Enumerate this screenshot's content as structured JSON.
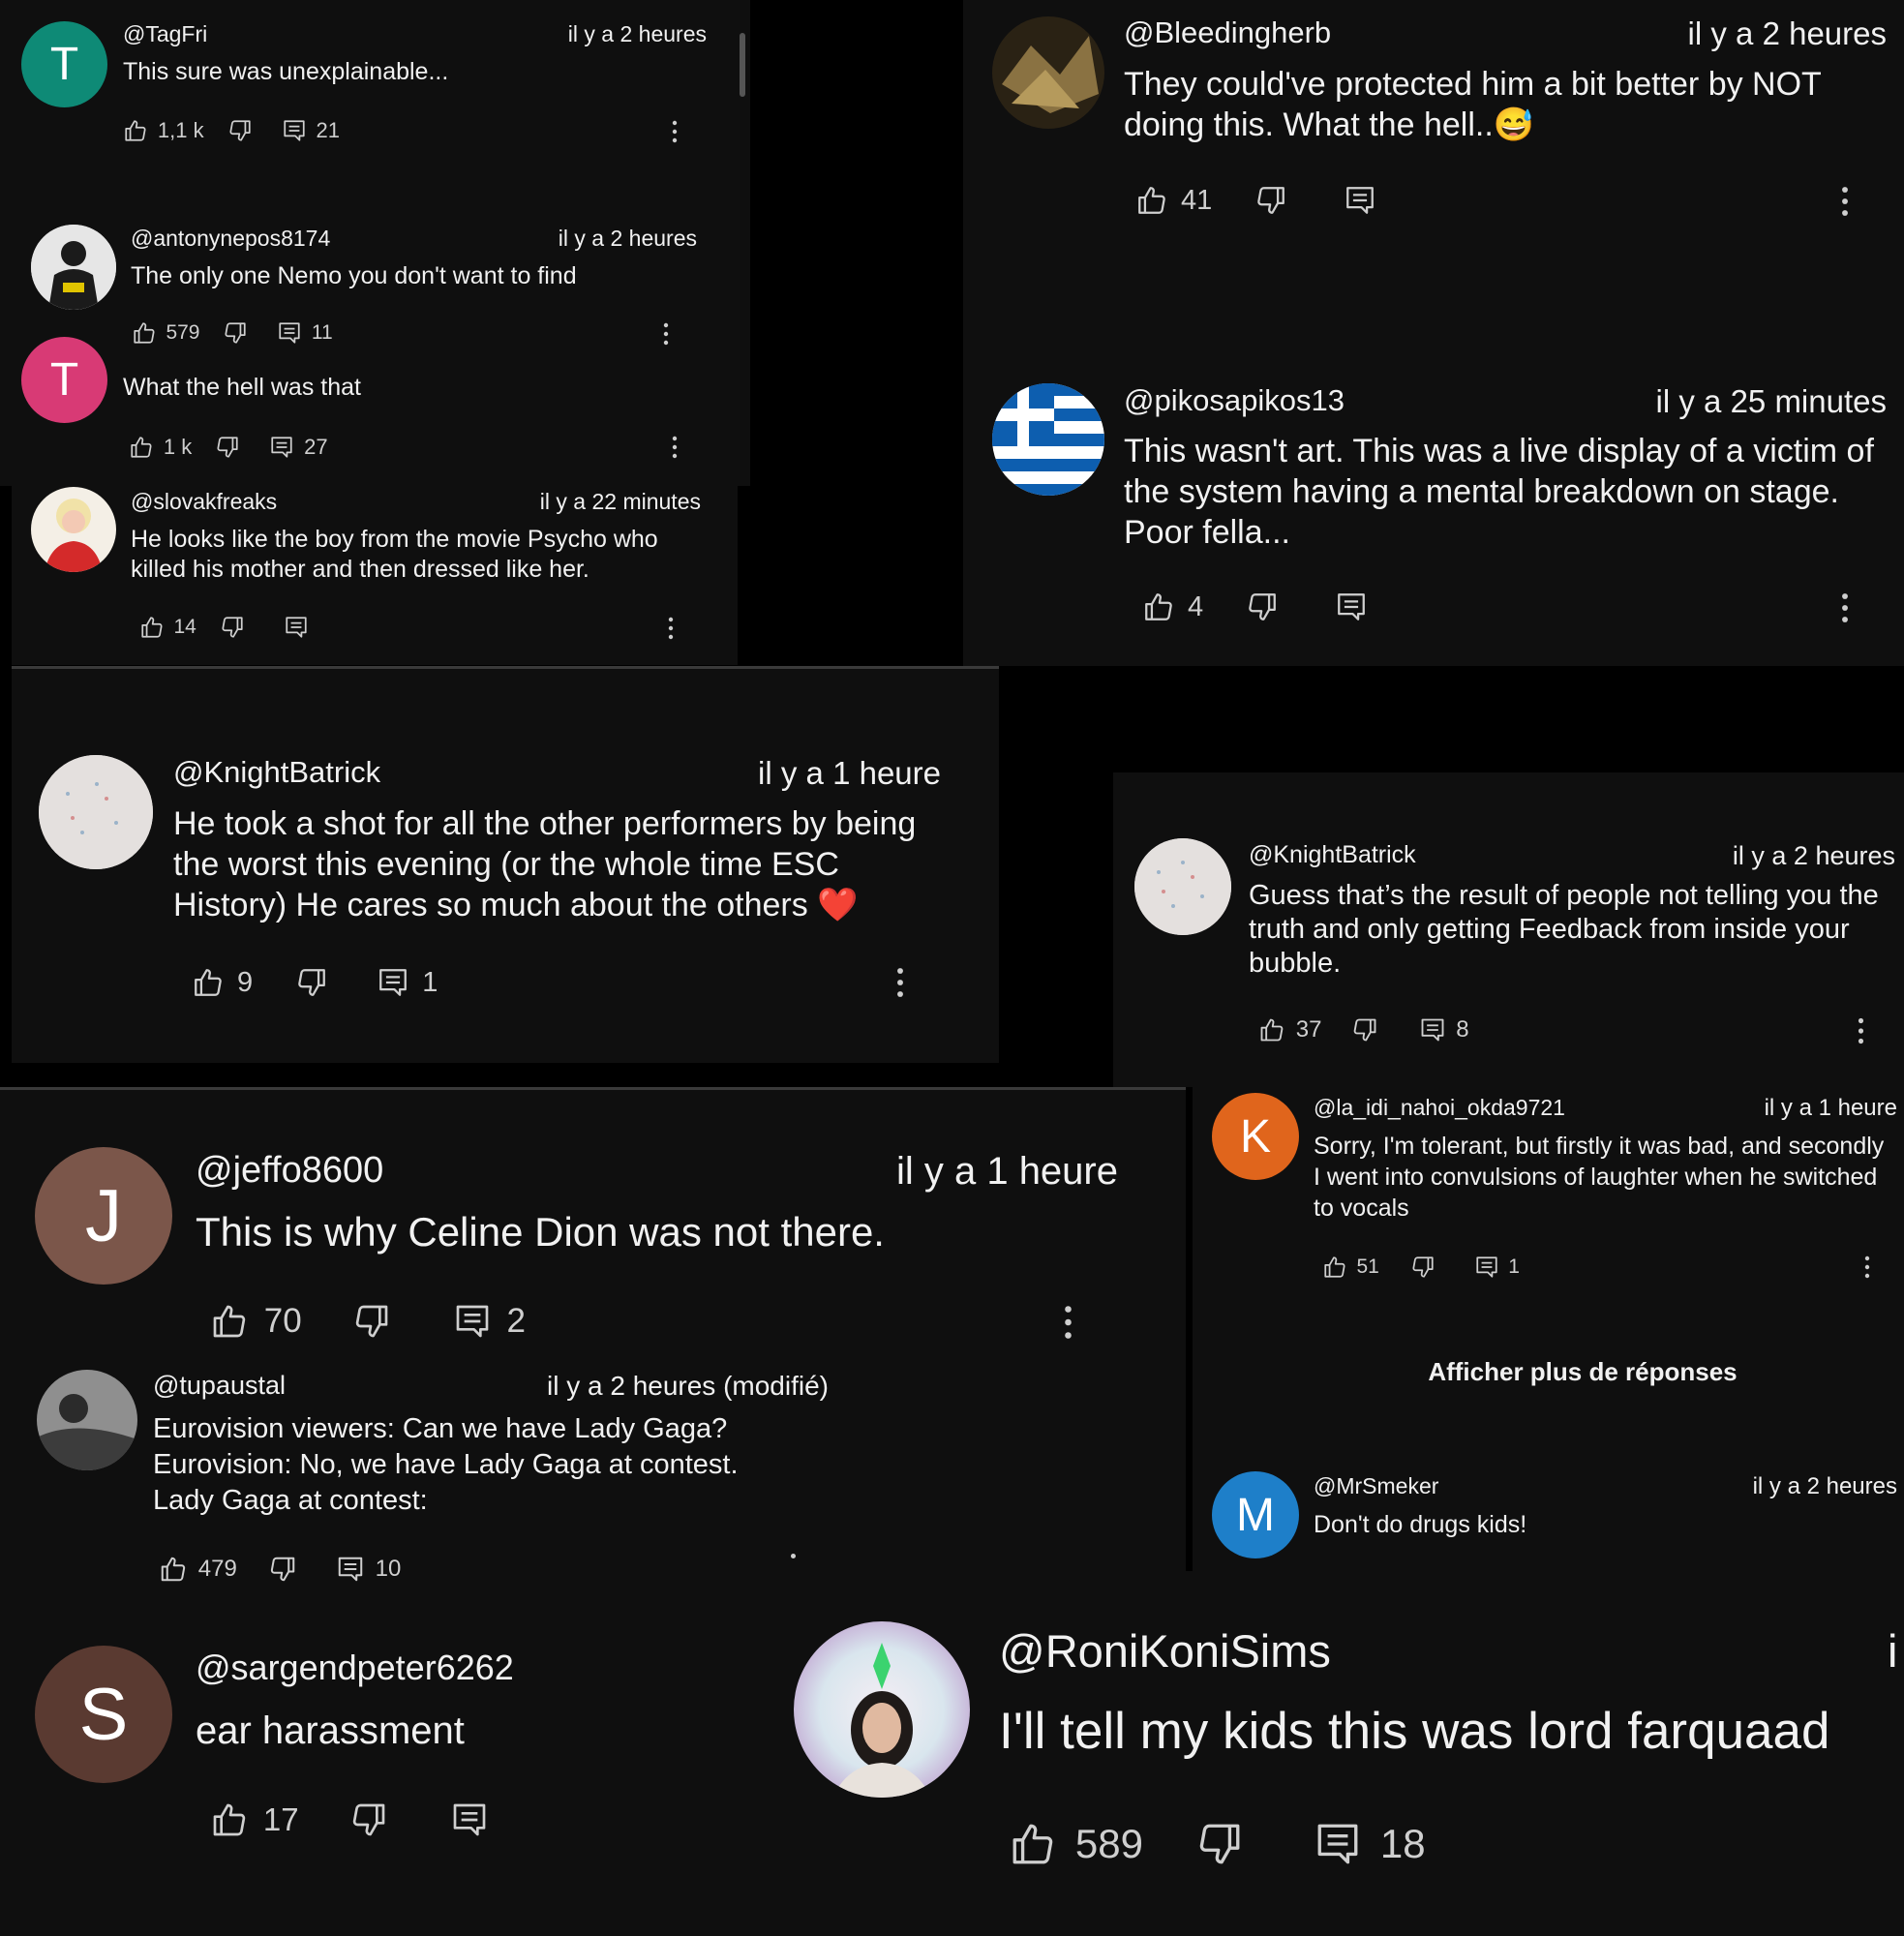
{
  "comments": [
    {
      "handle": "@TagFri",
      "time": "il y a 2 heures",
      "text": "This sure was unexplainable...",
      "likes": "1,1 k",
      "replies": "21",
      "avatar": {
        "letter": "T",
        "color": "#0e8a76"
      }
    },
    {
      "handle": "@antonynepos8174",
      "time": "il y a 2 heures",
      "text": "The only one Nemo you don't want to find",
      "likes": "579",
      "replies": "11"
    },
    {
      "text": "What the hell was that",
      "likes": "1 k",
      "replies": "27",
      "avatar": {
        "letter": "T",
        "color": "#d83a75"
      }
    },
    {
      "handle": "@slovakfreaks",
      "time": "il y a 22 minutes",
      "text": "He looks like the boy from the movie Psycho who killed his mother and then dressed like her.",
      "likes": "14",
      "replies": ""
    },
    {
      "handle": "@Bleedingherb",
      "time": "il y a 2 heures",
      "text": "They could've protected him a bit better by NOT doing this. What the hell..",
      "emoji": "😅",
      "likes": "41",
      "replies": ""
    },
    {
      "handle": "@pikosapikos13",
      "time": "il y a 25 minutes",
      "text": "This wasn't art. This was a live display of a victim of the system having a mental breakdown on stage. Poor fella...",
      "likes": "4",
      "replies": ""
    },
    {
      "handle": "@KnightBatrick",
      "time": "il y a 1 heure",
      "text": "He took a shot for all the other performers by being the worst this evening (or the whole time ESC History) He cares so much about the others",
      "emoji": "❤️",
      "likes": "9",
      "replies": "1"
    },
    {
      "handle": "@KnightBatrick",
      "time": "il y a 2 heures",
      "text": "Guess that’s the result of people not telling you the truth and only getting Feedback from inside your bubble.",
      "likes": "37",
      "replies": "8"
    },
    {
      "handle": "@jeffo8600",
      "time": "il y a 1 heure",
      "text": "This is why Celine Dion was not there.",
      "likes": "70",
      "replies": "2",
      "avatar": {
        "letter": "J",
        "color": "#7b564a"
      }
    },
    {
      "handle": "@la_idi_nahoi_okda9721",
      "time": "il y a 1 heure",
      "text": "Sorry, I'm tolerant, but firstly it was bad, and secondly I went into convulsions of laughter when he switched to vocals",
      "likes": "51",
      "replies": "1",
      "avatar": {
        "letter": "K",
        "color": "#e0651c"
      }
    },
    {
      "handle": "@tupaustal",
      "time": "il y a 2 heures (modifié)",
      "text_lines": [
        "Eurovision viewers: Can we have Lady Gaga?",
        "Eurovision: No, we have Lady Gaga at contest.",
        "Lady Gaga at contest:"
      ],
      "likes": "479",
      "replies": "10"
    },
    {
      "handle": "@MrSmeker",
      "time": "il y a 2 heures",
      "text": "Don't do drugs kids!",
      "avatar": {
        "letter": "M",
        "color": "#1e7fc9"
      }
    },
    {
      "handle": "@sargendpeter6262",
      "text": "ear harassment",
      "likes": "17",
      "replies": "",
      "avatar": {
        "letter": "S",
        "color": "#5a3a31"
      }
    },
    {
      "handle": "@RoniKoniSims",
      "time_fragment": "i",
      "text": "I'll tell my kids this was lord farquaad",
      "likes": "589",
      "replies": "18"
    }
  ],
  "show_more_replies": "Afficher plus de réponses",
  "colors": {
    "panel": "#0f0f0f",
    "text": "#f1f1f1",
    "icon": "#cfcfcf",
    "background": "#000000"
  }
}
